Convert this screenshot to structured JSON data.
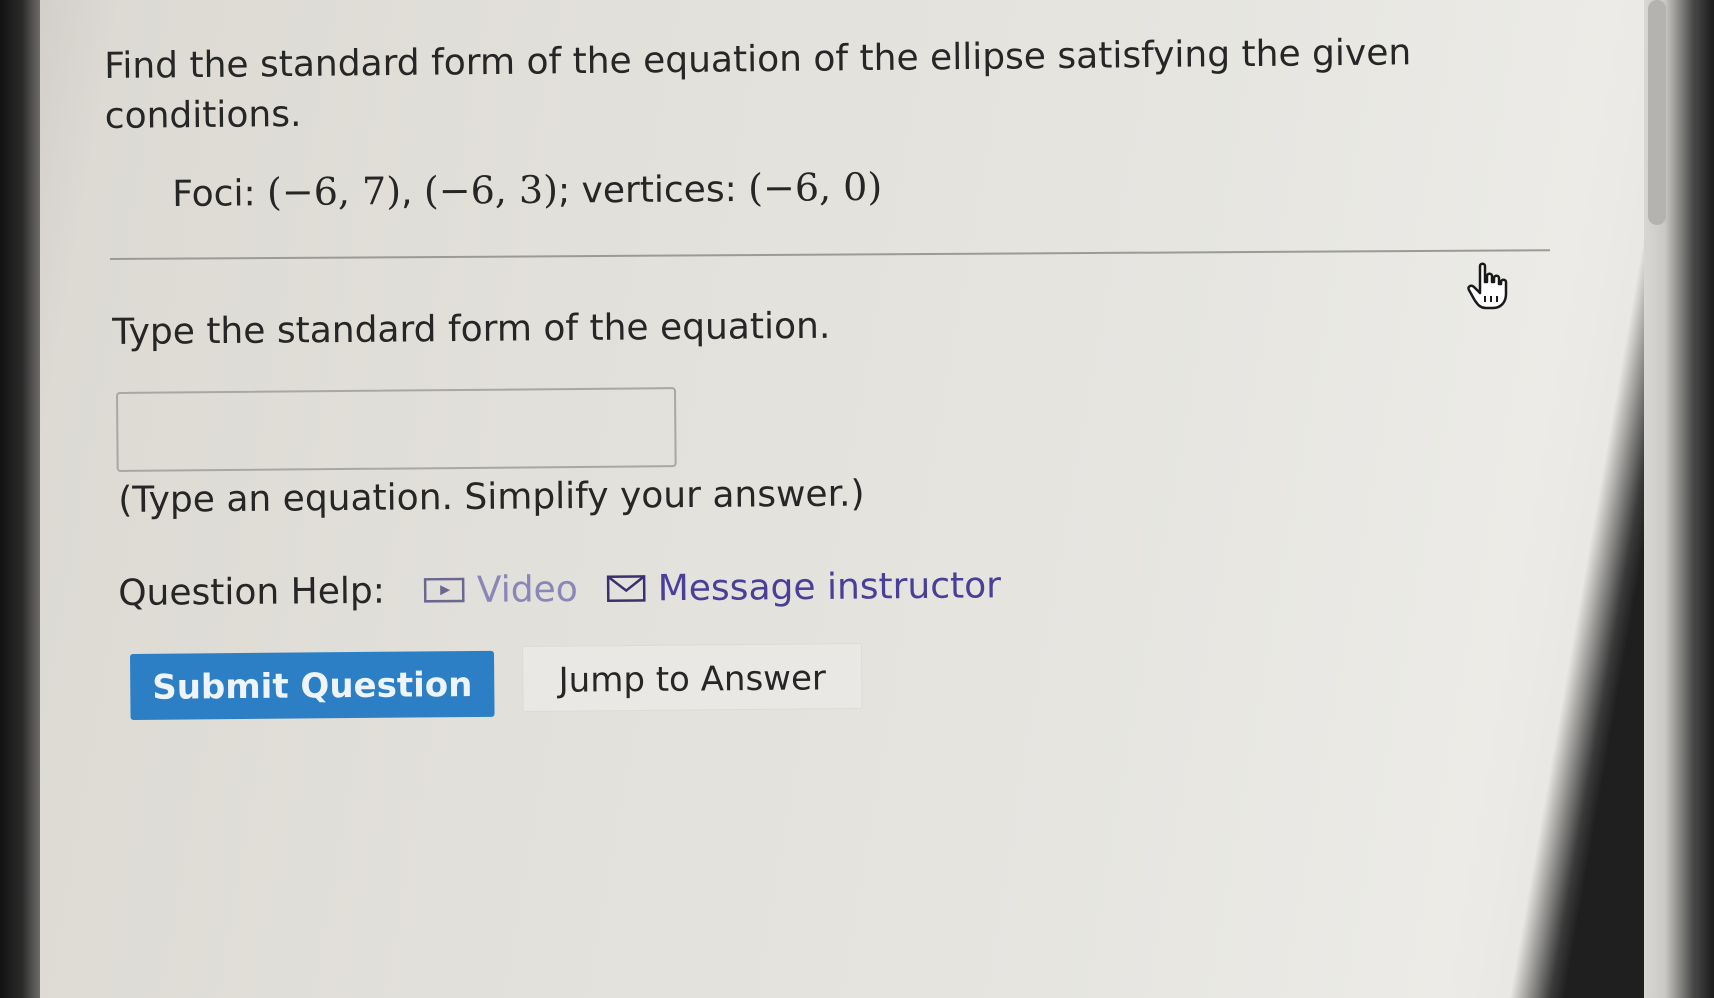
{
  "question": {
    "text": "Find the standard form of the equation of the ellipse satisfying the given conditions.",
    "conditions_label": "Foci: ",
    "foci_1": "(−6, 7)",
    "foci_sep": ", ",
    "foci_2": "(−6, 3)",
    "vertices_label": "; vertices: ",
    "vertices": "(−6, 0)"
  },
  "answer": {
    "prompt": "Type the standard form of the equation.",
    "value": "",
    "placeholder": "",
    "hint": "(Type an equation. Simplify your answer.)"
  },
  "help": {
    "label": "Question Help:",
    "video_label": "Video",
    "message_label": "Message instructor",
    "video_icon": "play-video-icon",
    "message_icon": "envelope-icon"
  },
  "actions": {
    "submit_label": "Submit Question",
    "jump_label": "Jump to Answer"
  },
  "colors": {
    "accent": "#2c7fc4",
    "link": "#4a3f98"
  }
}
